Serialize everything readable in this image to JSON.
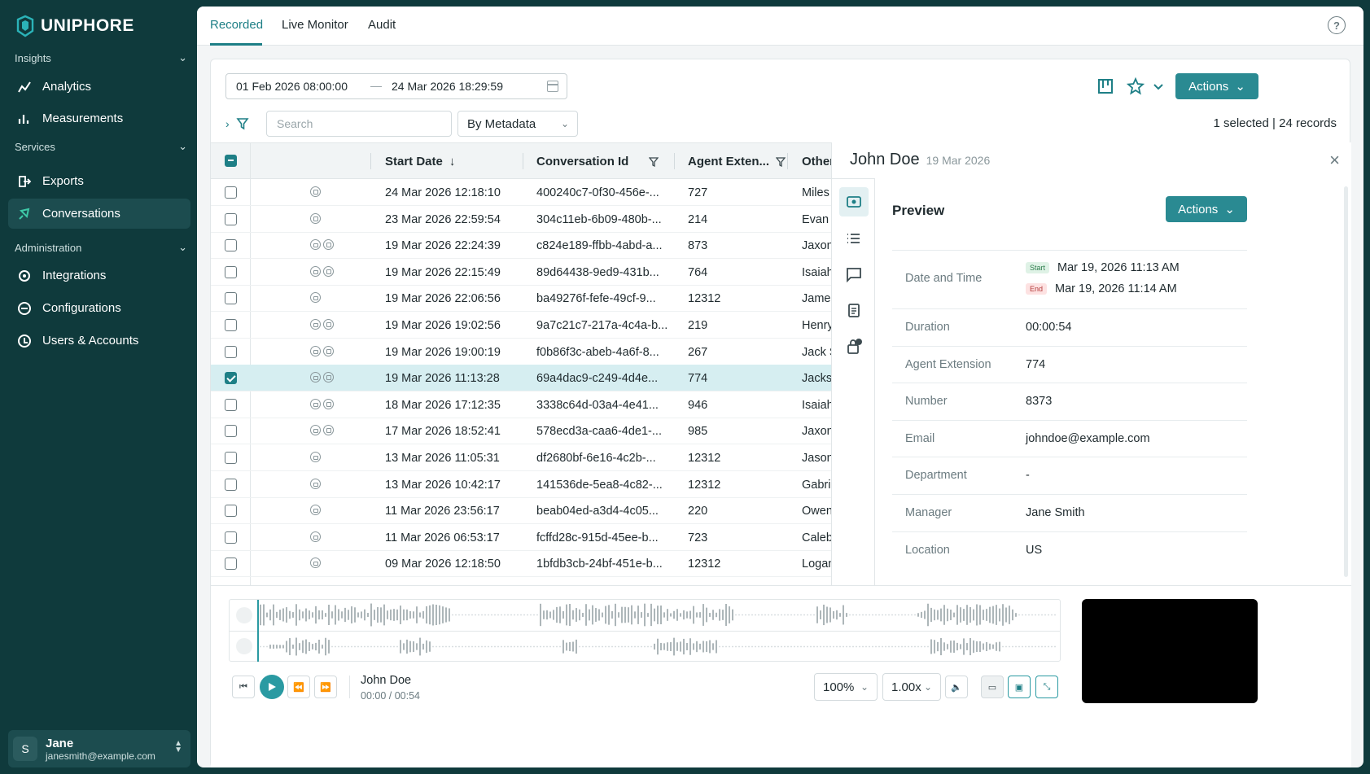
{
  "app": {
    "brand": "UNIPHORE"
  },
  "sidebar": {
    "sections": [
      {
        "label": "Insights",
        "items": [
          {
            "label": "Analytics",
            "icon": "analytics-icon"
          },
          {
            "label": "Measurements",
            "icon": "measurements-icon"
          }
        ]
      },
      {
        "label": "Services",
        "items": [
          {
            "label": "Exports",
            "icon": "exports-icon"
          },
          {
            "label": "Conversations",
            "icon": "conversations-icon",
            "active": true
          }
        ]
      },
      {
        "label": "Administration",
        "items": [
          {
            "label": "Integrations",
            "icon": "integrations-icon"
          },
          {
            "label": "Configurations",
            "icon": "configurations-icon"
          },
          {
            "label": "Users & Accounts",
            "icon": "users-icon"
          }
        ]
      }
    ],
    "user": {
      "initial": "S",
      "name": "Jane",
      "email": "janesmith@example.com"
    }
  },
  "tabs": [
    {
      "label": "Recorded",
      "active": true
    },
    {
      "label": "Live Monitor"
    },
    {
      "label": "Audit"
    }
  ],
  "toolbar": {
    "date_start": "01 Feb 2026 08:00:00",
    "date_end": "24 Mar 2026 18:29:59",
    "search_placeholder": "Search",
    "metadata_select": "By Metadata",
    "actions_label": "Actions",
    "selected_count": "1 selected",
    "records_count": "24 records"
  },
  "table": {
    "columns": [
      "Start Date",
      "Conversation Id",
      "Agent Exten...",
      "Other"
    ],
    "rows": [
      {
        "start": "24 Mar 2026 12:18:10",
        "id": "400240c7-0f30-456e-...",
        "ext": "727",
        "other": "Miles",
        "icons": "v"
      },
      {
        "start": "23 Mar 2026 22:59:54",
        "id": "304c11eb-6b09-480b-...",
        "ext": "214",
        "other": "Evan A",
        "icons": "v"
      },
      {
        "start": "19 Mar 2026 22:24:39",
        "id": "c824e189-ffbb-4abd-a...",
        "ext": "873",
        "other": "Jaxon",
        "icons": "lv"
      },
      {
        "start": "19 Mar 2026 22:15:49",
        "id": "89d64438-9ed9-431b...",
        "ext": "764",
        "other": "Isaiah",
        "icons": "lv"
      },
      {
        "start": "19 Mar 2026 22:06:56",
        "id": "ba49276f-fefe-49cf-9...",
        "ext": "12312",
        "other": "James",
        "icons": "l"
      },
      {
        "start": "19 Mar 2026 19:02:56",
        "id": "9a7c21c7-217a-4c4a-b...",
        "ext": "219",
        "other": "Henry",
        "icons": "lv"
      },
      {
        "start": "19 Mar 2026 19:00:19",
        "id": "f0b86f3c-abeb-4a6f-8...",
        "ext": "267",
        "other": "Jack S",
        "icons": "lv"
      },
      {
        "start": "19 Mar 2026 11:13:28",
        "id": "69a4dac9-c249-4d4e...",
        "ext": "774",
        "other": "Jacks",
        "icons": "lv",
        "selected": true
      },
      {
        "start": "18 Mar 2026 17:12:35",
        "id": "3338c64d-03a4-4e41...",
        "ext": "946",
        "other": "Isaiah",
        "icons": "lv"
      },
      {
        "start": "17 Mar 2026 18:52:41",
        "id": "578ecd3a-caa6-4de1-...",
        "ext": "985",
        "other": "Jaxon",
        "icons": "lv"
      },
      {
        "start": "13 Mar 2026 11:05:31",
        "id": "df2680bf-6e16-4c2b-...",
        "ext": "12312",
        "other": "Jason",
        "icons": "l"
      },
      {
        "start": "13 Mar 2026 10:42:17",
        "id": "141536de-5ea8-4c82-...",
        "ext": "12312",
        "other": "Gabrie",
        "icons": "l"
      },
      {
        "start": "11 Mar 2026 23:56:17",
        "id": "beab04ed-a3d4-4c05...",
        "ext": "220",
        "other": "Owen",
        "icons": "l"
      },
      {
        "start": "11 Mar 2026 06:53:17",
        "id": "fcffd28c-915d-45ee-b...",
        "ext": "723",
        "other": "Caleb",
        "icons": "l"
      },
      {
        "start": "09 Mar 2026 12:18:50",
        "id": "1bfdb3cb-24bf-451e-b...",
        "ext": "12312",
        "other": "Logan",
        "icons": "l"
      }
    ]
  },
  "detail": {
    "name": "John Doe",
    "date": "19 Mar 2026",
    "section_title": "Preview",
    "actions_label": "Actions",
    "badge_count": "1",
    "date_time_label": "Date and Time",
    "start_tag": "Start",
    "end_tag": "End",
    "start_value": "Mar 19, 2026 11:13 AM",
    "end_value": "Mar 19, 2026 11:14 AM",
    "fields": [
      {
        "label": "Duration",
        "value": "00:00:54"
      },
      {
        "label": "Agent Extension",
        "value": "774"
      },
      {
        "label": "Number",
        "value": "8373"
      },
      {
        "label": "Email",
        "value": "johndoe@example.com"
      },
      {
        "label": "Department",
        "value": "-"
      },
      {
        "label": "Manager",
        "value": "Jane Smith"
      },
      {
        "label": "Location",
        "value": "US"
      }
    ]
  },
  "player": {
    "name": "John Doe",
    "current": "00:00",
    "total": "/ 00:54",
    "volume": "100%",
    "speed": "1.00x"
  },
  "colors": {
    "accent": "#1e7f86",
    "sidebar": "#0f3a3c",
    "button": "#2a8a92"
  }
}
